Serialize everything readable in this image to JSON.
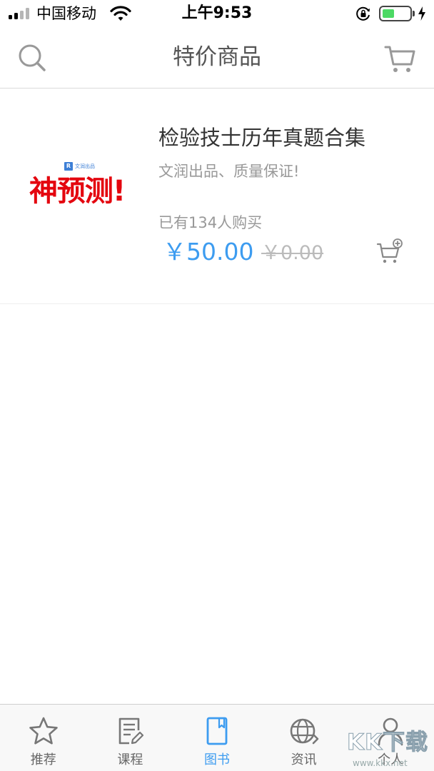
{
  "status_bar": {
    "carrier": "中国移动",
    "time": "上午9:53",
    "battery_level": 0.45,
    "icons": [
      "signal-icon",
      "wifi-icon",
      "rotation-lock-icon",
      "battery-icon",
      "charging-bolt-icon"
    ]
  },
  "nav": {
    "title": "特价商品",
    "left_icon": "search-icon",
    "right_icon": "cart-icon"
  },
  "product": {
    "cover_brand": "文润出品",
    "cover_text": "神预测!",
    "title": "检验技士历年真题合集",
    "subtitle": "文润出品、质量保证!",
    "sold_text": "已有134人购买",
    "price": "￥50.00",
    "original_price": "￥0.00",
    "action_icon": "add-to-cart-icon"
  },
  "tabs": [
    {
      "label": "推荐",
      "icon": "star-icon",
      "active": false
    },
    {
      "label": "课程",
      "icon": "document-edit-icon",
      "active": false
    },
    {
      "label": "图书",
      "icon": "book-icon",
      "active": true
    },
    {
      "label": "资讯",
      "icon": "globe-icon",
      "active": false
    },
    {
      "label": "个人",
      "icon": "person-icon",
      "active": false
    }
  ],
  "watermark": {
    "logo": "KK下载",
    "url": "www.kkx.net"
  },
  "colors": {
    "accent": "#3d9cf0",
    "battery_green": "#4cd964",
    "cover_red": "#e4060f",
    "muted_text": "#999999",
    "tab_inactive": "#666666"
  }
}
